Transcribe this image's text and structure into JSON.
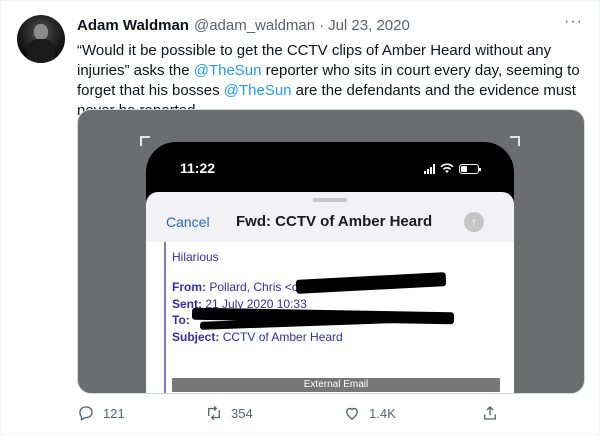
{
  "tweet": {
    "author_name": "Adam Waldman",
    "handle": "@adam_waldman",
    "separator": "·",
    "date": "Jul 23, 2020",
    "more_label": "···",
    "text": {
      "p1": "“Would it be possible to get the CCTV clips of Amber Heard without any injuries” asks the ",
      "mention1": "@TheSun",
      "p2": " reporter who sits in court every day, seeming to forget that his bosses ",
      "mention2": "@TheSun",
      "p3": " are the defendants and the evidence must never be reported."
    }
  },
  "media": {
    "phone_time": "11:22",
    "cancel_label": "Cancel",
    "email_title": "Fwd: CCTV of Amber Heard",
    "send_icon": "arrow-up-icon",
    "body_first_line": "Hilarious",
    "from_label": "From:",
    "from_value": "Pollard, Chris <c.",
    "sent_label": "Sent:",
    "sent_value": "21 July 2020 10:33",
    "to_label": "To:",
    "subject_label": "Subject:",
    "subject_value": "CCTV of Amber Heard",
    "external_label": "External Email"
  },
  "actions": {
    "reply_count": "121",
    "retweet_count": "354",
    "like_count": "1.4K"
  },
  "colors": {
    "accent": "#1d9bf0",
    "muted": "#536471",
    "email_blue": "#2f2fa8"
  }
}
